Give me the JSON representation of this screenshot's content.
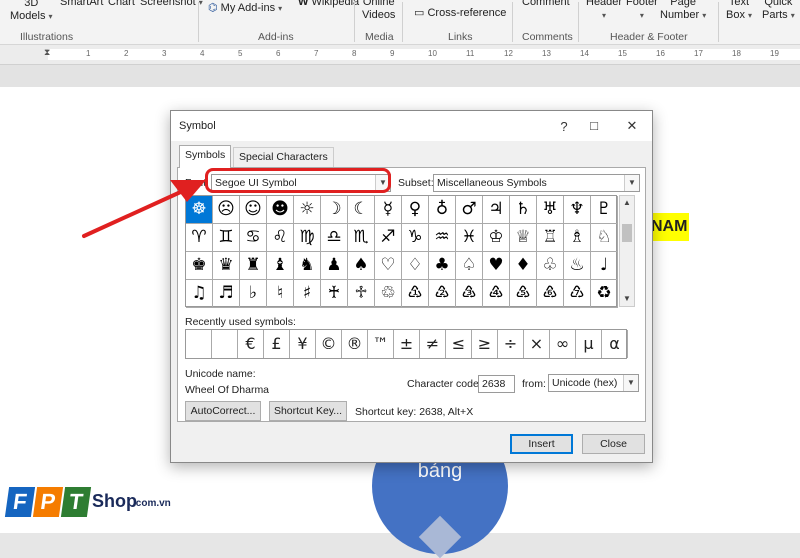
{
  "ribbon": {
    "items": [
      {
        "label": "3D\nModels",
        "caret": true
      },
      {
        "label": "SmartArt"
      },
      {
        "label": "Chart"
      },
      {
        "label": "Screenshot",
        "caret": true
      },
      {
        "label": "My Add-ins",
        "caret": true
      },
      {
        "label": "Wikipedia"
      },
      {
        "label": "Online\nVideos"
      },
      {
        "label": "Cross-reference"
      },
      {
        "label": "Comment"
      },
      {
        "label": "Header",
        "caret": true
      },
      {
        "label": "Footer",
        "caret": true
      },
      {
        "label": "Page\nNumber",
        "caret": true
      },
      {
        "label": "Text\nBox",
        "caret": true
      },
      {
        "label": "Quick\nParts",
        "caret": true
      }
    ],
    "groups": [
      "Illustrations",
      "Add-ins",
      "Media",
      "Links",
      "Comments",
      "Header & Footer"
    ]
  },
  "ruler": {
    "numbers": [
      "1",
      "2",
      "3",
      "4",
      "5",
      "6",
      "7",
      "8",
      "9",
      "10",
      "11",
      "12",
      "13",
      "14",
      "15",
      "16",
      "17",
      "18",
      "19"
    ]
  },
  "document": {
    "highlight_text": "NAM",
    "circle_text": "bảng"
  },
  "logo": {
    "f": "F",
    "p": "P",
    "t": "T",
    "shop": "Shop",
    "domain": ".com.vn",
    "colors": {
      "f": "#1565c0",
      "p": "#f57c00",
      "t": "#2e7d32"
    }
  },
  "dialog": {
    "title": "Symbol",
    "controls": {
      "minimize": "?",
      "maximize": "□",
      "close": "✕"
    },
    "tabs": [
      "Symbols",
      "Special Characters"
    ],
    "font_label": "Font:",
    "font_value": "Segoe UI Symbol",
    "subset_label": "Subset:",
    "subset_value": "Miscellaneous Symbols",
    "symbols": [
      "☸",
      "☹",
      "☺",
      "☻",
      "☼",
      "☽",
      "☾",
      "☿",
      "♀",
      "♁",
      "♂",
      "♃",
      "♄",
      "♅",
      "♆",
      "♇",
      "♈",
      "♊",
      "♋",
      "♌",
      "♍",
      "♎",
      "♏",
      "♐",
      "♑",
      "♒",
      "♓",
      "♔",
      "♕",
      "♖",
      "♗",
      "♘",
      "♚",
      "♛",
      "♜",
      "♝",
      "♞",
      "♟",
      "♠",
      "♡",
      "♢",
      "♣",
      "♤",
      "♥",
      "♦",
      "♧",
      "♨",
      "♩",
      "♫",
      "♬",
      "♭",
      "♮",
      "♯",
      "♰",
      "♱",
      "♲",
      "♳",
      "♴",
      "♵",
      "♶",
      "♷",
      "♸",
      "♹",
      "♻"
    ],
    "selected_index": 0,
    "recent_label": "Recently used symbols:",
    "recent": [
      " ",
      " ",
      "€",
      "£",
      "¥",
      "©",
      "®",
      "™",
      "±",
      "≠",
      "≤",
      "≥",
      "÷",
      "×",
      "∞",
      "µ",
      "α"
    ],
    "unicode_name_label": "Unicode name:",
    "unicode_name_value": "Wheel Of Dharma",
    "char_code_label": "Character code:",
    "char_code_value": "2638",
    "from_label": "from:",
    "from_value": "Unicode (hex)",
    "autocorrect": "AutoCorrect...",
    "shortcut_key_btn": "Shortcut Key...",
    "shortcut_text": "Shortcut key: 2638, Alt+X",
    "insert": "Insert",
    "close": "Close"
  },
  "annotation_color": "#e02020"
}
